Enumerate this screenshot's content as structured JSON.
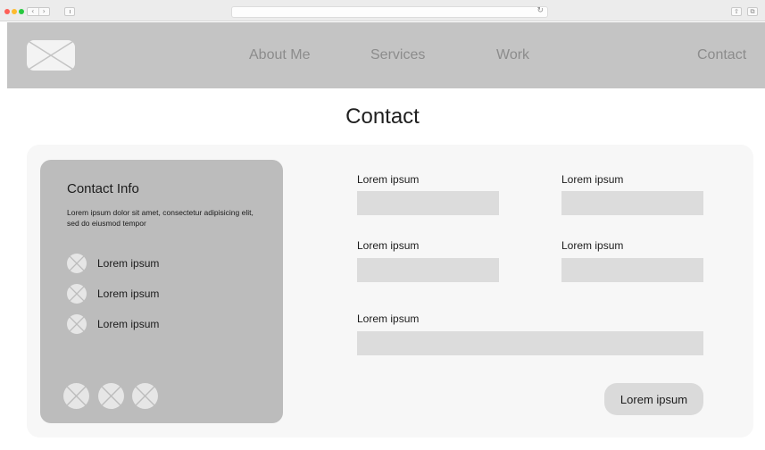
{
  "browser": {
    "back_glyph": "‹",
    "forward_glyph": "›",
    "reload_glyph": "↻",
    "share_glyph": "⇧",
    "tabs_glyph": "⧉"
  },
  "header": {
    "logo_icon": "image-placeholder-icon",
    "nav": {
      "about": "About Me",
      "services": "Services",
      "work": "Work",
      "contact": "Contact"
    }
  },
  "page": {
    "title": "Contact"
  },
  "contact_info": {
    "title": "Contact Info",
    "description": "Lorem ipsum dolor sit amet, consectetur adipisicing elit, sed do eiusmod tempor",
    "items": [
      {
        "label": "Lorem ipsum",
        "icon": "placeholder-circle-icon"
      },
      {
        "label": "Lorem ipsum",
        "icon": "placeholder-circle-icon"
      },
      {
        "label": "Lorem ipsum",
        "icon": "placeholder-circle-icon"
      }
    ],
    "social_icons": [
      "social-placeholder-icon",
      "social-placeholder-icon",
      "social-placeholder-icon"
    ]
  },
  "form": {
    "fields": [
      {
        "label": "Lorem ipsum",
        "value": ""
      },
      {
        "label": "Lorem ipsum",
        "value": ""
      },
      {
        "label": "Lorem ipsum",
        "value": ""
      },
      {
        "label": "Lorem ipsum",
        "value": ""
      },
      {
        "label": "Lorem ipsum",
        "value": ""
      }
    ],
    "submit_label": "Lorem ipsum"
  },
  "colors": {
    "header_bg": "#c4c4c4",
    "card_bg": "#bcbcbc",
    "input_bg": "#dcdcdc",
    "panel_bg": "#f7f7f7"
  }
}
